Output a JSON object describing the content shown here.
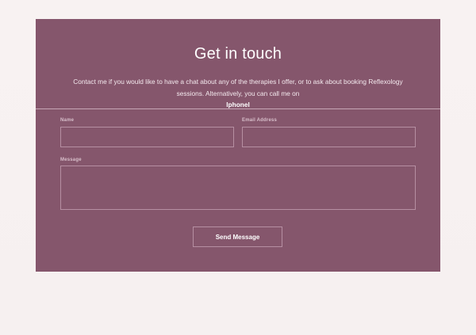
{
  "contact": {
    "title": "Get in touch",
    "intro": "Contact me if you would like to have a chat about any of the therapies I offer, or to ask about booking Reflexology sessions. Alternatively, you can call me on",
    "phone": "Iphonel",
    "form": {
      "name_label": "Name",
      "email_label": "Email Address",
      "message_label": "Message",
      "name_value": "",
      "email_value": "",
      "message_value": "",
      "submit_label": "Send Message"
    }
  },
  "colors": {
    "page_background": "#f7f1f1",
    "card_background": "#85566c",
    "field_border": "#b68fa2",
    "text": "#ffffff"
  }
}
